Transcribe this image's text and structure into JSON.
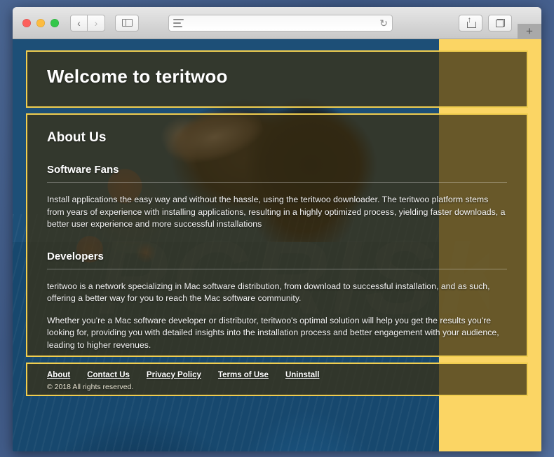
{
  "browser": {
    "traffic_lights": [
      "close",
      "minimize",
      "maximize"
    ],
    "back_label": "‹",
    "forward_label": "›",
    "sidebar_icon": "sidebar-icon",
    "address_value": "",
    "address_placeholder": "",
    "reader_icon": "reader-icon",
    "reload_icon": "↻",
    "share_icon": "share-icon",
    "tabs_icon": "tabs-icon",
    "new_tab_label": "+"
  },
  "page": {
    "hero": {
      "title": "Welcome to teritwoo"
    },
    "about": {
      "heading": "About Us",
      "sections": [
        {
          "subheading": "Software Fans",
          "paragraphs": [
            "Install applications the easy way and without the hassle, using the teritwoo downloader. The teritwoo platform stems from years of experience with installing applications, resulting in a highly optimized process, yielding faster downloads, a better user experience and more successful installations"
          ]
        },
        {
          "subheading": "Developers",
          "paragraphs": [
            "teritwoo is a network specializing in Mac software distribution, from download to successful installation, and as such, offering a better way for you to reach the Mac software community.",
            "Whether you're a Mac software developer or distributor, teritwoo's optimal solution will help you get the results you're looking for, providing you with detailed insights into the installation process and better engagement with your audience, leading to higher revenues."
          ]
        }
      ]
    },
    "footer": {
      "links": [
        {
          "label": "About"
        },
        {
          "label": "Contact Us"
        },
        {
          "label": "Privacy Policy"
        },
        {
          "label": "Terms of Use"
        },
        {
          "label": "Uninstall"
        }
      ],
      "copyright": "© 2018 All rights reserved."
    },
    "watermark": "PCRISK",
    "colors": {
      "page_background": "#fbd564",
      "panel_border": "#f0cd4f",
      "panel_fill": "rgba(58,48,22,0.76)",
      "text": "#ffffff",
      "desktop": "#456090"
    }
  }
}
